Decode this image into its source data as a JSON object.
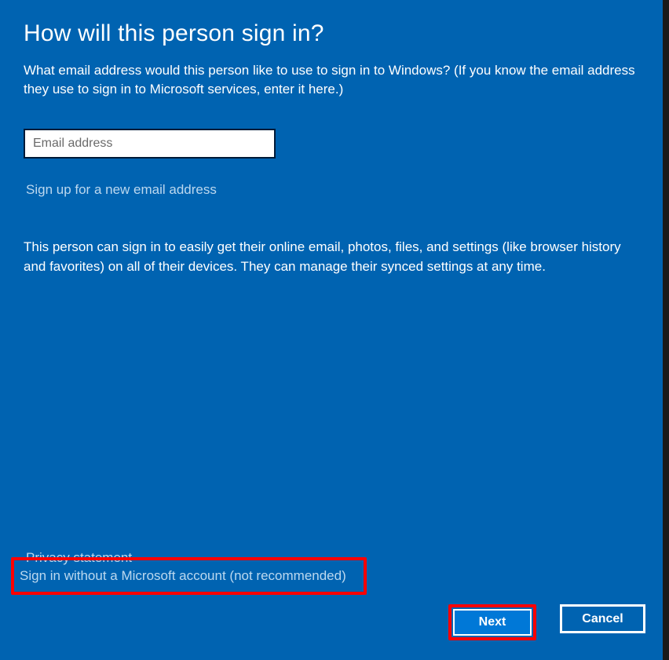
{
  "heading": "How will this person sign in?",
  "subtext": "What email address would this person like to use to sign in to Windows? (If you know the email address they use to sign in to Microsoft services, enter it here.)",
  "emailInput": {
    "placeholder": "Email address",
    "value": ""
  },
  "links": {
    "signup": "Sign up for a new email address",
    "privacy": "Privacy statement",
    "noAccount": "Sign in without a Microsoft account (not recommended)"
  },
  "description": "This person can sign in to easily get their online email, photos, files, and settings (like browser history and favorites) on all of their devices. They can manage their synced settings at any time.",
  "buttons": {
    "next": "Next",
    "cancel": "Cancel"
  }
}
